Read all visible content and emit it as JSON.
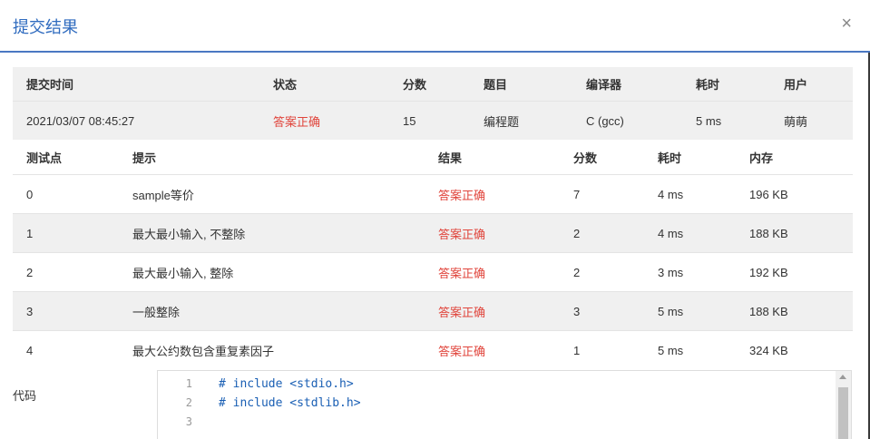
{
  "modal": {
    "title": "提交结果",
    "close_glyph": "×"
  },
  "summary": {
    "headers": [
      "提交时间",
      "状态",
      "分数",
      "题目",
      "编译器",
      "耗时",
      "用户"
    ],
    "row": [
      "2021/03/07 08:45:27",
      "答案正确",
      "15",
      "编程题",
      "C (gcc)",
      "5 ms",
      "萌萌"
    ]
  },
  "tests": {
    "headers": [
      "测试点",
      "提示",
      "结果",
      "分数",
      "耗时",
      "内存"
    ],
    "rows": [
      [
        "0",
        "sample等价",
        "答案正确",
        "7",
        "4 ms",
        "196 KB"
      ],
      [
        "1",
        "最大最小输入, 不整除",
        "答案正确",
        "2",
        "4 ms",
        "188 KB"
      ],
      [
        "2",
        "最大最小输入, 整除",
        "答案正确",
        "2",
        "3 ms",
        "192 KB"
      ],
      [
        "3",
        "一般整除",
        "答案正确",
        "3",
        "5 ms",
        "188 KB"
      ],
      [
        "4",
        "最大公约数包含重复素因子",
        "答案正确",
        "1",
        "5 ms",
        "324 KB"
      ]
    ]
  },
  "code": {
    "label": "代码",
    "lines": [
      {
        "num": "1",
        "text": "# include <stdio.h>"
      },
      {
        "num": "2",
        "text": "# include <stdlib.h>"
      },
      {
        "num": "3",
        "text": ""
      }
    ]
  },
  "colors": {
    "accent": "#2f6bbf",
    "status_ok": "#e0443b",
    "header_bg": "#f0f0f0"
  }
}
